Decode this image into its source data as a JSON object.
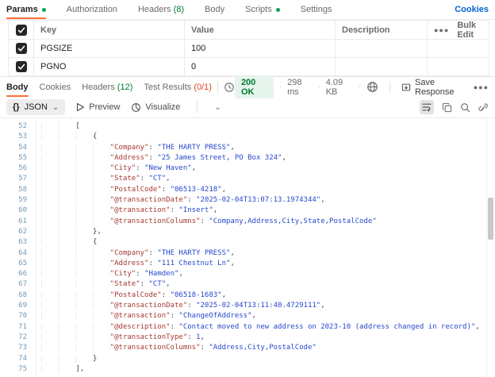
{
  "colors": {
    "accent_orange": "#ff6c37",
    "green_dot": "#00a353",
    "green_count": "#007f31",
    "red_count": "#d9481c",
    "status_green": "#007a2f",
    "status_bg": "#e6f5ec",
    "link_blue": "#0265d2",
    "json_key": "#a63a33",
    "json_string": "#2749cc",
    "line_number": "#7298b5"
  },
  "icons": {
    "history": "clock-history-icon",
    "globe": "globe-icon",
    "save": "save-icon",
    "more": "ellipsis-icon",
    "preview": "play-outline-icon",
    "visualize": "visualize-icon",
    "wrap": "wrap-text-icon",
    "copy": "copy-icon",
    "search": "magnifier-icon",
    "link": "link-icon",
    "checkbox": "checkbox-checked-icon"
  },
  "request_tabs": {
    "items": [
      {
        "label": "Params",
        "dot": true,
        "active": true
      },
      {
        "label": "Authorization"
      },
      {
        "label": "Headers",
        "suffix": "(8)",
        "suffix_color": "green"
      },
      {
        "label": "Body"
      },
      {
        "label": "Scripts",
        "dot": true
      },
      {
        "label": "Settings"
      }
    ],
    "cookies_link": "Cookies"
  },
  "params_table": {
    "columns": [
      "Key",
      "Value",
      "Description"
    ],
    "bulk_edit_label": "Bulk Edit",
    "rows": [
      {
        "key": "PGSIZE",
        "value": "100",
        "description": "",
        "checked": true
      },
      {
        "key": "PGNO",
        "value": "0",
        "description": "",
        "checked": true
      }
    ]
  },
  "response": {
    "tabs": [
      {
        "label": "Body",
        "active": true
      },
      {
        "label": "Cookies"
      },
      {
        "label": "Headers",
        "suffix": "(12)",
        "suffix_color": "green"
      },
      {
        "label": "Test Results",
        "suffix": "(0/1)",
        "suffix_color": "red"
      }
    ],
    "status": "200 OK",
    "time": "298 ms",
    "size": "4.09 KB",
    "save_label": "Save Response",
    "format_label": "JSON",
    "preview_label": "Preview",
    "visualize_label": "Visualize"
  },
  "code": {
    "lines": [
      {
        "n": 52,
        "t": [
          [
            "w",
            "        "
          ],
          [
            "p",
            "["
          ]
        ]
      },
      {
        "n": 53,
        "t": [
          [
            "w",
            "            "
          ],
          [
            "p",
            "{"
          ]
        ]
      },
      {
        "n": 54,
        "t": [
          [
            "w",
            "                "
          ],
          [
            "k",
            "\"Company\""
          ],
          [
            "p",
            ": "
          ],
          [
            "s",
            "\"THE HARTY PRESS\""
          ],
          [
            "p",
            ","
          ]
        ]
      },
      {
        "n": 55,
        "t": [
          [
            "w",
            "                "
          ],
          [
            "k",
            "\"Address\""
          ],
          [
            "p",
            ": "
          ],
          [
            "s",
            "\"25 James Street, PO Box 324\""
          ],
          [
            "p",
            ","
          ]
        ]
      },
      {
        "n": 56,
        "t": [
          [
            "w",
            "                "
          ],
          [
            "k",
            "\"City\""
          ],
          [
            "p",
            ": "
          ],
          [
            "s",
            "\"New Haven\""
          ],
          [
            "p",
            ","
          ]
        ]
      },
      {
        "n": 57,
        "t": [
          [
            "w",
            "                "
          ],
          [
            "k",
            "\"State\""
          ],
          [
            "p",
            ": "
          ],
          [
            "s",
            "\"CT\""
          ],
          [
            "p",
            ","
          ]
        ]
      },
      {
        "n": 58,
        "t": [
          [
            "w",
            "                "
          ],
          [
            "k",
            "\"PostalCode\""
          ],
          [
            "p",
            ": "
          ],
          [
            "s",
            "\"06513-4218\""
          ],
          [
            "p",
            ","
          ]
        ]
      },
      {
        "n": 59,
        "t": [
          [
            "w",
            "                "
          ],
          [
            "k",
            "\"@transactionDate\""
          ],
          [
            "p",
            ": "
          ],
          [
            "s",
            "\"2025-02-04T13:07:13.1974344\""
          ],
          [
            "p",
            ","
          ]
        ]
      },
      {
        "n": 60,
        "t": [
          [
            "w",
            "                "
          ],
          [
            "k",
            "\"@transaction\""
          ],
          [
            "p",
            ": "
          ],
          [
            "s",
            "\"Insert\""
          ],
          [
            "p",
            ","
          ]
        ]
      },
      {
        "n": 61,
        "t": [
          [
            "w",
            "                "
          ],
          [
            "k",
            "\"@transactionColumns\""
          ],
          [
            "p",
            ": "
          ],
          [
            "s",
            "\"Company,Address,City,State,PostalCode\""
          ]
        ]
      },
      {
        "n": 62,
        "t": [
          [
            "w",
            "            "
          ],
          [
            "p",
            "},"
          ]
        ]
      },
      {
        "n": 63,
        "t": [
          [
            "w",
            "            "
          ],
          [
            "p",
            "{"
          ]
        ]
      },
      {
        "n": 64,
        "t": [
          [
            "w",
            "                "
          ],
          [
            "k",
            "\"Company\""
          ],
          [
            "p",
            ": "
          ],
          [
            "s",
            "\"THE HARTY PRESS\""
          ],
          [
            "p",
            ","
          ]
        ]
      },
      {
        "n": 65,
        "t": [
          [
            "w",
            "                "
          ],
          [
            "k",
            "\"Address\""
          ],
          [
            "p",
            ": "
          ],
          [
            "s",
            "\"111 Chestnut Ln\""
          ],
          [
            "p",
            ","
          ]
        ]
      },
      {
        "n": 66,
        "t": [
          [
            "w",
            "                "
          ],
          [
            "k",
            "\"City\""
          ],
          [
            "p",
            ": "
          ],
          [
            "s",
            "\"Hamden\""
          ],
          [
            "p",
            ","
          ]
        ]
      },
      {
        "n": 67,
        "t": [
          [
            "w",
            "                "
          ],
          [
            "k",
            "\"State\""
          ],
          [
            "p",
            ": "
          ],
          [
            "s",
            "\"CT\""
          ],
          [
            "p",
            ","
          ]
        ]
      },
      {
        "n": 68,
        "t": [
          [
            "w",
            "                "
          ],
          [
            "k",
            "\"PostalCode\""
          ],
          [
            "p",
            ": "
          ],
          [
            "s",
            "\"06518-1683\""
          ],
          [
            "p",
            ","
          ]
        ]
      },
      {
        "n": 69,
        "t": [
          [
            "w",
            "                "
          ],
          [
            "k",
            "\"@transactionDate\""
          ],
          [
            "p",
            ": "
          ],
          [
            "s",
            "\"2025-02-04T13:11:40.4729111\""
          ],
          [
            "p",
            ","
          ]
        ]
      },
      {
        "n": 70,
        "t": [
          [
            "w",
            "                "
          ],
          [
            "k",
            "\"@transaction\""
          ],
          [
            "p",
            ": "
          ],
          [
            "s",
            "\"ChangeOfAddress\""
          ],
          [
            "p",
            ","
          ]
        ]
      },
      {
        "n": 71,
        "t": [
          [
            "w",
            "                "
          ],
          [
            "k",
            "\"@description\""
          ],
          [
            "p",
            ": "
          ],
          [
            "s",
            "\"Contact moved to new address on 2023-10 (address changed in record)\""
          ],
          [
            "p",
            ","
          ]
        ]
      },
      {
        "n": 72,
        "t": [
          [
            "w",
            "                "
          ],
          [
            "k",
            "\"@transactionType\""
          ],
          [
            "p",
            ": "
          ],
          [
            "n",
            "1"
          ],
          [
            "p",
            ","
          ]
        ]
      },
      {
        "n": 73,
        "t": [
          [
            "w",
            "                "
          ],
          [
            "k",
            "\"@transactionColumns\""
          ],
          [
            "p",
            ": "
          ],
          [
            "s",
            "\"Address,City,PostalCode\""
          ]
        ]
      },
      {
        "n": 74,
        "t": [
          [
            "w",
            "            "
          ],
          [
            "p",
            "}"
          ]
        ]
      },
      {
        "n": 75,
        "t": [
          [
            "w",
            "        "
          ],
          [
            "p",
            "],"
          ]
        ]
      }
    ]
  }
}
